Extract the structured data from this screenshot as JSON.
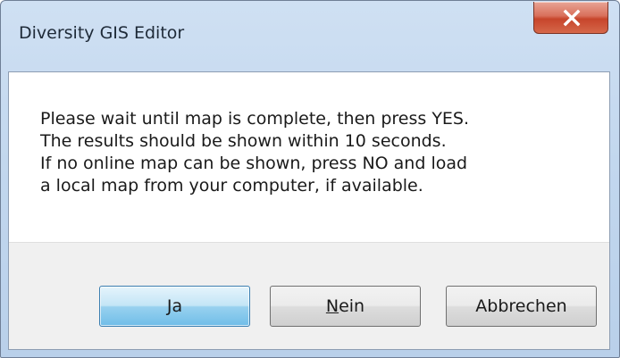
{
  "window": {
    "title": "Diversity GIS Editor",
    "close_icon": "close-icon"
  },
  "message": {
    "lines": [
      "Please wait until map is complete, then press YES.",
      "The results should be shown within 10 seconds.",
      "If no online map can be shown, press NO and load",
      "a local map from your computer, if available."
    ]
  },
  "buttons": {
    "yes_label": "Ja",
    "no_mnemonic": "N",
    "no_rest": "ein",
    "cancel_label": "Abbrechen"
  },
  "colors": {
    "close_button": "#c7452b",
    "default_button": "#98d1ef",
    "title_bar": "#c2d7ee"
  }
}
